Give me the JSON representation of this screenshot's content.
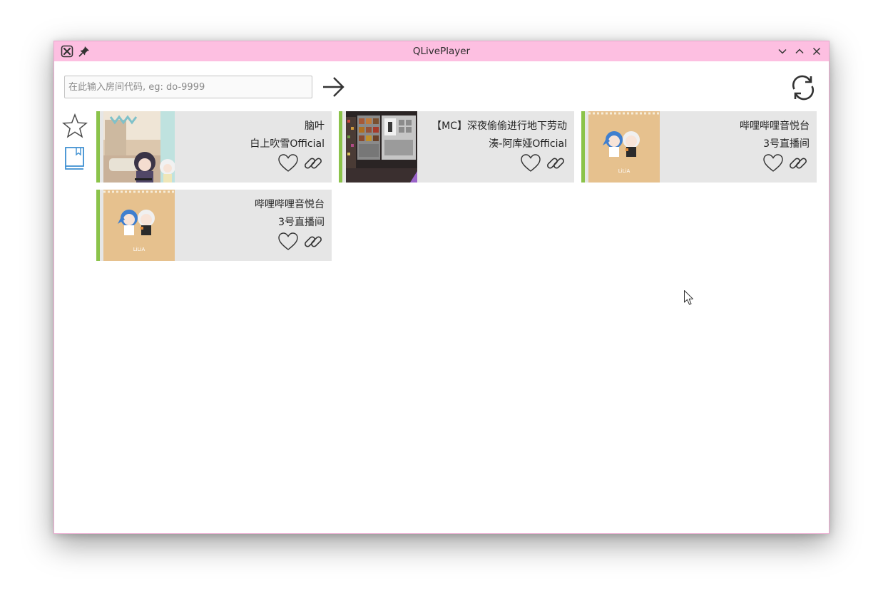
{
  "window": {
    "title": "QLivePlayer",
    "titlebar_color": "#fdbfe1"
  },
  "search": {
    "placeholder": "在此输入房间代码, eg: do-9999",
    "value": ""
  },
  "icons": {
    "app": "app-icon",
    "pin": "pin-icon",
    "go": "arrow-right-icon",
    "refresh": "refresh-icon",
    "favorites": "star-icon",
    "history": "book-icon",
    "like": "heart-icon",
    "copy_link": "link-icon"
  },
  "colors": {
    "live_indicator": "#8bc34a",
    "card_background": "#e6e6e6",
    "history_icon": "#3d8fd1"
  },
  "rooms": [
    {
      "title": "脑叶",
      "streamer": "白上吹雪Official",
      "status": "live"
    },
    {
      "title": "【MC】深夜偷偷进行地下劳动",
      "streamer": "湊-阿库娅Official",
      "status": "live"
    },
    {
      "title": "哔哩哔哩音悦台",
      "streamer": "3号直播间",
      "status": "live"
    },
    {
      "title": "哔哩哔哩音悦台",
      "streamer": "3号直播间",
      "status": "live"
    }
  ]
}
